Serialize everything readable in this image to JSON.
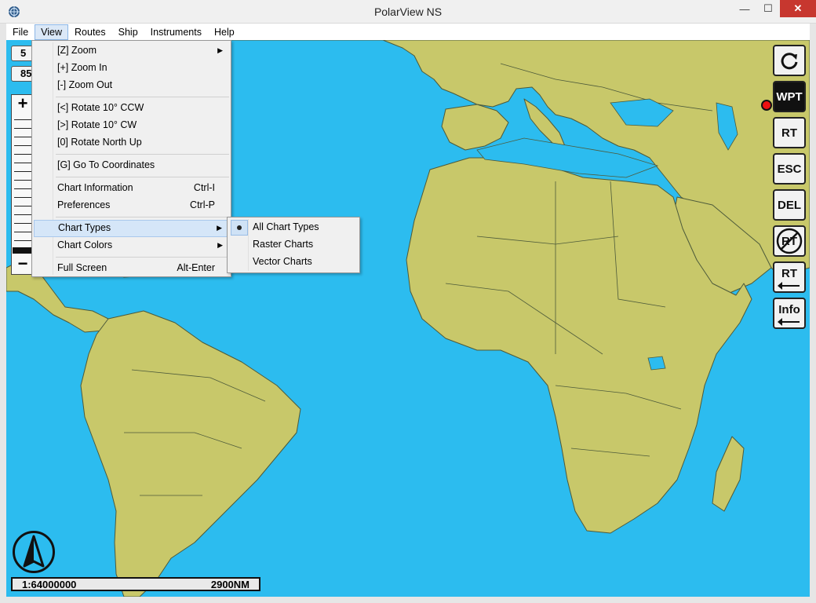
{
  "window": {
    "title": "PolarView NS",
    "minimize": "—",
    "maximize": "☐",
    "close": "✕"
  },
  "menubar": [
    "File",
    "View",
    "Routes",
    "Ship",
    "Instruments",
    "Help"
  ],
  "view_menu": {
    "zoom": "[Z] Zoom",
    "zoom_in": "[+] Zoom In",
    "zoom_out": "[-] Zoom Out",
    "rotate_ccw": "[<] Rotate 10° CCW",
    "rotate_cw": "[>] Rotate 10° CW",
    "rotate_north": "[0] Rotate North Up",
    "goto": "[G] Go To Coordinates",
    "chart_info": "Chart Information",
    "chart_info_shortcut": "Ctrl-I",
    "preferences": "Preferences",
    "preferences_shortcut": "Ctrl-P",
    "chart_types": "Chart Types",
    "chart_colors": "Chart Colors",
    "full_screen": "Full Screen",
    "full_screen_shortcut": "Alt-Enter"
  },
  "chart_types_menu": {
    "all": "All Chart Types",
    "raster": "Raster Charts",
    "vector": "Vector Charts",
    "selected": "All Chart Types"
  },
  "toolbar": {
    "refresh_icon": "refresh-icon",
    "wpt": "WPT",
    "rt": "RT",
    "esc": "ESC",
    "del": "DEL",
    "rt_cancel": "RT",
    "rt_back": "RT",
    "info": "Info"
  },
  "readouts": {
    "top": "5",
    "second": "85"
  },
  "zoom": {
    "plus": "+",
    "minus": "−"
  },
  "scale": {
    "ratio": "1:64000000",
    "distance": "2900NM"
  },
  "colors": {
    "sea": "#2cbcef",
    "land": "#c8c86a",
    "border": "#4d5a3a",
    "menu_highlight": "#d5e6f8"
  }
}
